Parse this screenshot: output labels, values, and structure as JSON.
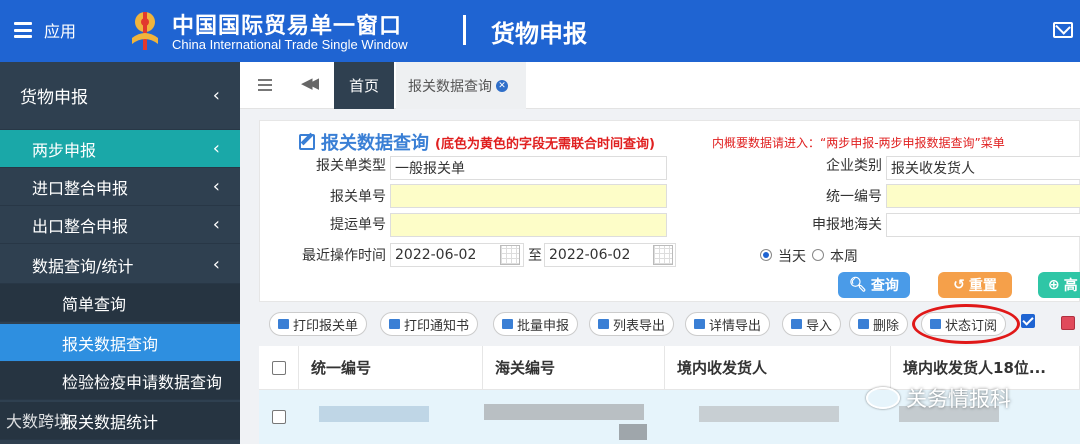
{
  "header": {
    "menu_label": "应用",
    "brand_cn": "中国国际贸易单一窗口",
    "brand_en": "China International Trade Single Window",
    "module_title": "货物申报",
    "bg_color": "#1f64d2"
  },
  "sidebar": {
    "group": "货物申报",
    "items": [
      {
        "label": "两步申报"
      },
      {
        "label": "进口整合申报"
      },
      {
        "label": "出口整合申报"
      },
      {
        "label": "数据查询/统计"
      }
    ],
    "subitems": [
      {
        "label": "简单查询"
      },
      {
        "label": "报关数据查询"
      },
      {
        "label": "检验检疫申请数据查询"
      },
      {
        "label": "报关数据统计"
      }
    ]
  },
  "tabs": {
    "home": "首页",
    "current": "报关数据查询"
  },
  "form": {
    "title": "报关数据查询",
    "note": "(底色为黄色的字段无需联合时间查询)",
    "hint": "内概要数据请进入：“两步申报-两步申报数据查询”菜单",
    "fields": {
      "decl_type_label": "报关单类型",
      "decl_type_value": "一般报关单",
      "decl_no_label": "报关单号",
      "bill_no_label": "提运单号",
      "recent_time_label": "最近操作时间",
      "date_from": "2022-06-02",
      "date_sep": "至",
      "date_to": "2022-06-02",
      "company_type_label": "企业类别",
      "company_type_value": "报关收发货人",
      "unified_no_label": "统一编号",
      "customs_label": "申报地海关"
    },
    "radio_today": "当天",
    "radio_week": "本周",
    "btn_query": "查询",
    "btn_reset": "重置",
    "btn_advanced": "高"
  },
  "toolbar": {
    "print_decl": "打印报关单",
    "print_notice": "打印通知书",
    "batch_declare": "批量申报",
    "list_export": "列表导出",
    "detail_export": "详情导出",
    "import": "导入",
    "delete": "删除",
    "status_subscribe": "状态订阅"
  },
  "table": {
    "columns": [
      "统一编号",
      "海关编号",
      "境内收发货人",
      "境内收发货人18位..."
    ]
  },
  "watermark": {
    "text": "关务情报科",
    "corner": "大数跨境"
  }
}
